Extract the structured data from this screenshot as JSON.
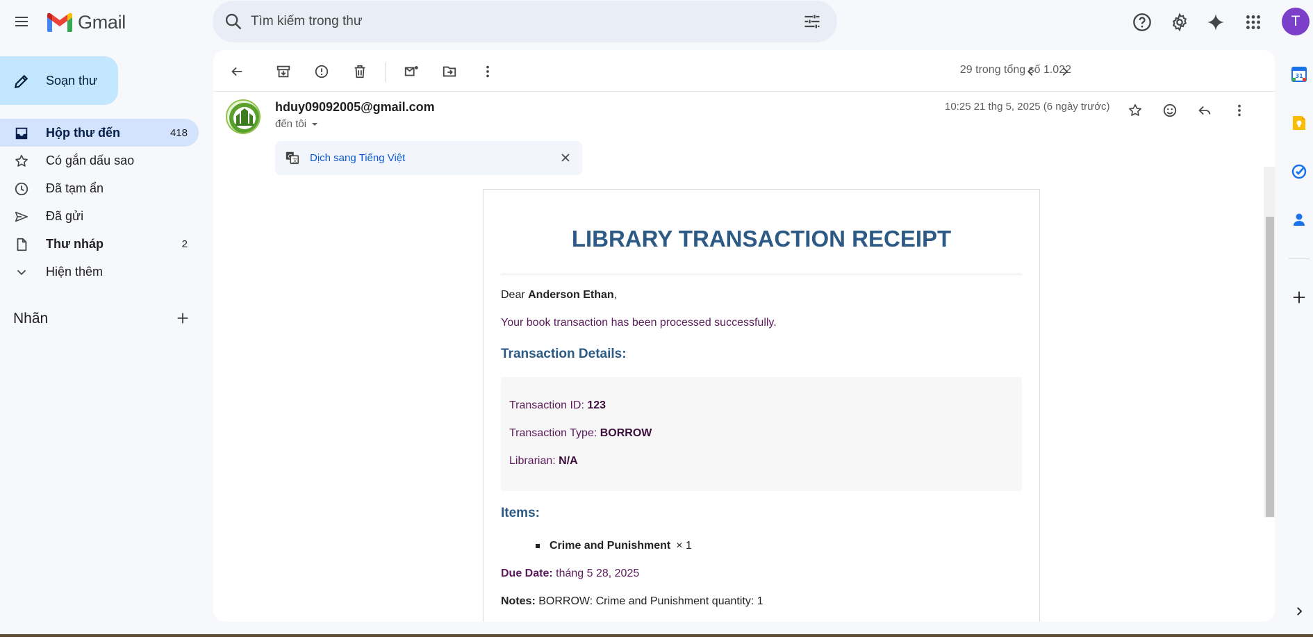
{
  "app": {
    "name": "Gmail"
  },
  "search": {
    "placeholder": "Tìm kiếm trong thư"
  },
  "avatar": {
    "initial": "T",
    "color": "#7b3fc9"
  },
  "sidebar": {
    "compose_label": "Soạn thư",
    "items": [
      {
        "label": "Hộp thư đến",
        "count": "418",
        "icon": "inbox-icon"
      },
      {
        "label": "Có gắn dấu sao",
        "count": "",
        "icon": "star-icon"
      },
      {
        "label": "Đã tạm ẩn",
        "count": "",
        "icon": "clock-icon"
      },
      {
        "label": "Đã gửi",
        "count": "",
        "icon": "send-icon"
      },
      {
        "label": "Thư nháp",
        "count": "2",
        "icon": "draft-icon"
      },
      {
        "label": "Hiện thêm",
        "count": "",
        "icon": "chevron-down-icon"
      }
    ],
    "labels_title": "Nhãn"
  },
  "toolbar": {
    "pager": "29 trong tổng số 1.022"
  },
  "message": {
    "sender": "hduy09092005@gmail.com",
    "to": "đến tôi",
    "date": "10:25 21 thg 5, 2025 (6 ngày trước)"
  },
  "translate": {
    "label": "Dịch sang Tiếng Việt"
  },
  "email": {
    "title": "LIBRARY TRANSACTION RECEIPT",
    "greeting_prefix": "Dear ",
    "recipient_name": "Anderson Ethan",
    "greeting_suffix": ",",
    "success_message": "Your book transaction has been processed successfully.",
    "details_heading": "Transaction Details:",
    "details": [
      {
        "label": "Transaction ID: ",
        "value": "123"
      },
      {
        "label": "Transaction Type: ",
        "value": "BORROW"
      },
      {
        "label": "Librarian: ",
        "value": "N/A"
      }
    ],
    "items_heading": "Items:",
    "items": [
      {
        "title": "Crime and Punishment",
        "qty": "× 1"
      }
    ],
    "due_label": "Due Date:",
    "due_value": " tháng 5 28, 2025",
    "notes_label": "Notes:",
    "notes_value": " BORROW: Crime and Punishment quantity: 1"
  },
  "colors": {
    "compose_bg": "#c2e7ff",
    "active_nav_bg": "#d3e3fd",
    "title_blue": "#2c5a85",
    "purple_text": "#5c1a5c",
    "link_blue": "#0b57d0"
  }
}
